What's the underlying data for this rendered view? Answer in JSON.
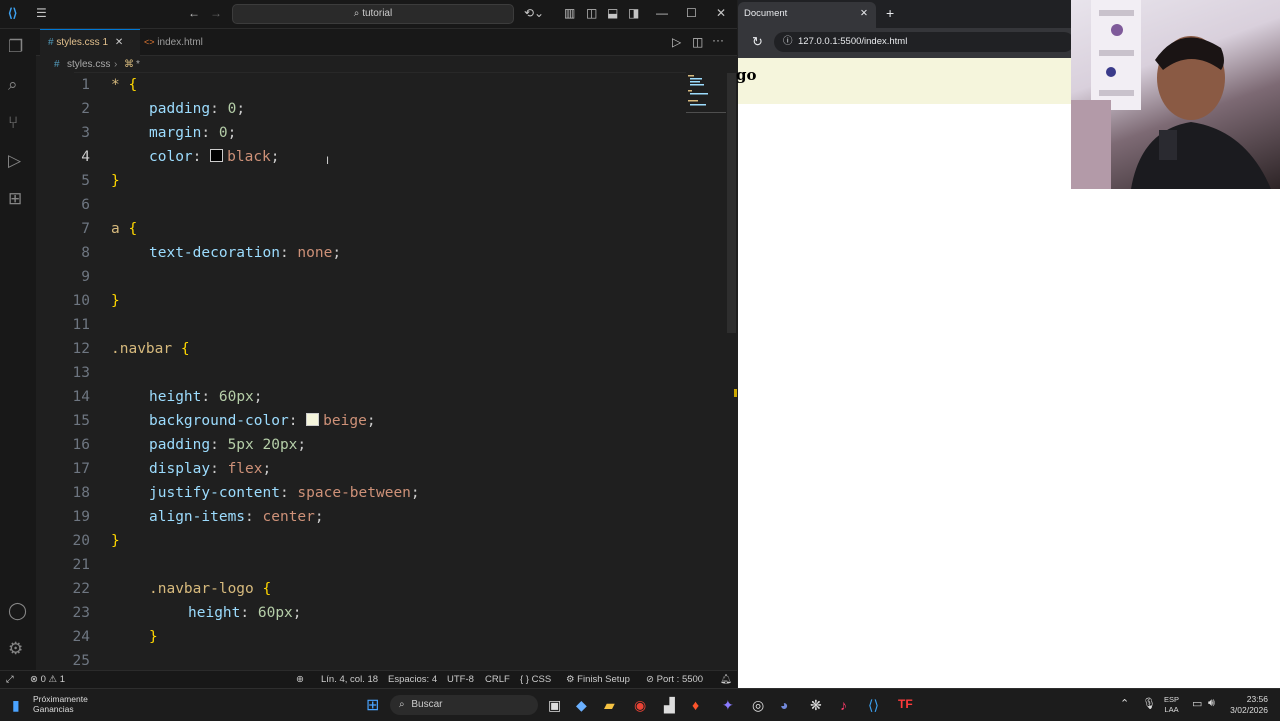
{
  "vscode": {
    "search_text": "tutorial",
    "tabs": [
      {
        "label": "styles.css",
        "badge": "1",
        "icon": "#"
      },
      {
        "label": "index.html",
        "icon": "<>"
      }
    ],
    "breadcrumb": {
      "file": "styles.css",
      "symbol": "*"
    },
    "lines": [
      {
        "n": "1"
      },
      {
        "n": "2"
      },
      {
        "n": "3"
      },
      {
        "n": "4"
      },
      {
        "n": "5"
      },
      {
        "n": "6"
      },
      {
        "n": "7"
      },
      {
        "n": "8"
      },
      {
        "n": "9"
      },
      {
        "n": "10"
      },
      {
        "n": "11"
      },
      {
        "n": "12"
      },
      {
        "n": "13"
      },
      {
        "n": "14"
      },
      {
        "n": "15"
      },
      {
        "n": "16"
      },
      {
        "n": "17"
      },
      {
        "n": "18"
      },
      {
        "n": "19"
      },
      {
        "n": "20"
      },
      {
        "n": "21"
      },
      {
        "n": "22"
      },
      {
        "n": "23"
      },
      {
        "n": "24"
      },
      {
        "n": "25"
      }
    ],
    "code": {
      "l1": {
        "sel": "*",
        "br": "{"
      },
      "l2": {
        "prop": "padding",
        "val": "0"
      },
      "l3": {
        "prop": "margin",
        "val": "0"
      },
      "l4": {
        "prop": "color",
        "val": "black",
        "swatch": "#000000"
      },
      "l5": {
        "br": "}"
      },
      "l7": {
        "sel": "a",
        "br": "{"
      },
      "l8": {
        "prop": "text-decoration",
        "val": "none"
      },
      "l10": {
        "br": "}"
      },
      "l12": {
        "sel": ".navbar",
        "br": "{"
      },
      "l14": {
        "prop": "height",
        "val": "60px"
      },
      "l15": {
        "prop": "background-color",
        "val": "beige",
        "swatch": "#f5f5dc"
      },
      "l16": {
        "prop": "padding",
        "val": "5px 20px"
      },
      "l17": {
        "prop": "display",
        "val": "flex"
      },
      "l18": {
        "prop": "justify-content",
        "val": "space-between"
      },
      "l19": {
        "prop": "align-items",
        "val": "center"
      },
      "l20": {
        "br": "}"
      },
      "l22": {
        "sel": ".navbar-logo",
        "br": "{"
      },
      "l23": {
        "prop": "height",
        "val": "60px"
      },
      "l24": {
        "br": "}"
      }
    },
    "status": {
      "errors": "0",
      "warnings": "1",
      "position": "Lín. 4, col. 18",
      "spaces": "Espacios: 4",
      "encoding": "UTF-8",
      "eol": "CRLF",
      "language": "CSS",
      "finish_setup": "Finish Setup",
      "port": "Port : 5500"
    }
  },
  "browser": {
    "tab_title": "Document",
    "url": "127.0.0.1:5500/index.html",
    "page_logo_text": "go"
  },
  "taskbar": {
    "weather_title": "Próximamente",
    "weather_sub": "Ganancias",
    "search_label": "Buscar",
    "lang_top": "ESP",
    "lang_bottom": "LAA",
    "time": "23:56",
    "date": "3/02/2026"
  }
}
